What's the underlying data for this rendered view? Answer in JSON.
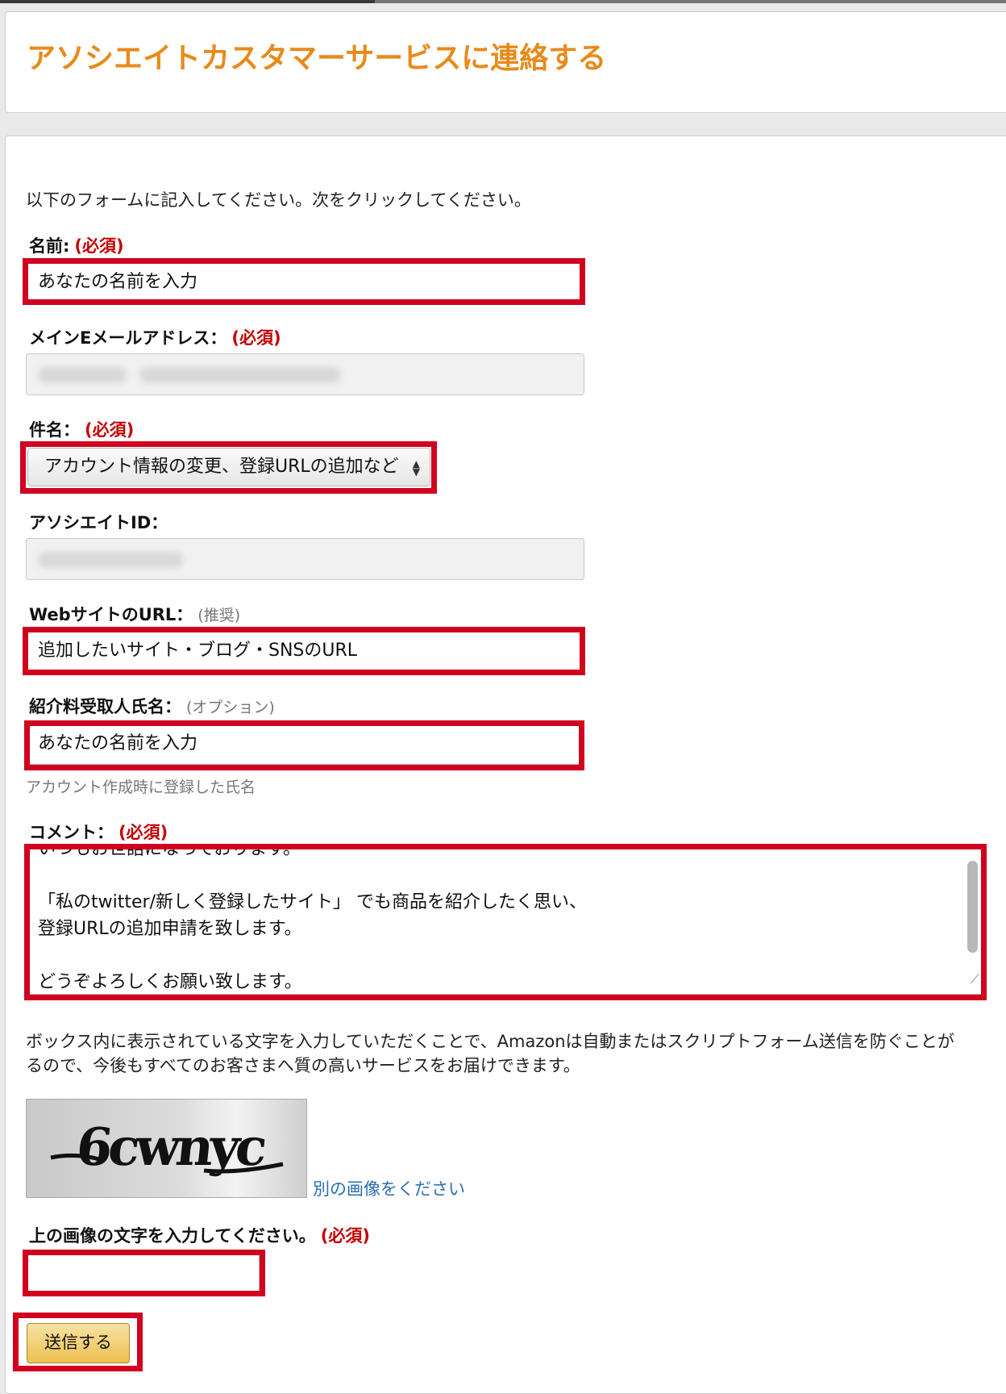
{
  "page": {
    "title": "アソシエイトカスタマーサービスに連絡する"
  },
  "form": {
    "intro": "以下のフォームに記入してください。次をクリックしてください。",
    "required_mark": "(必須)",
    "name": {
      "label": "名前:",
      "value": "あなたの名前を入力"
    },
    "email": {
      "label": "メインEメールアドレス：",
      "value": ""
    },
    "subject": {
      "label": "件名：",
      "selected": "アカウント情報の変更、登録URLの追加など"
    },
    "associate_id": {
      "label": "アソシエイトID：",
      "value": ""
    },
    "website": {
      "label": "WebサイトのURL：",
      "note": "(推奨)",
      "value": "追加したいサイト・ブログ・SNSのURL"
    },
    "payee": {
      "label": "紹介料受取人氏名：",
      "note": "(オプション)",
      "value": "あなたの名前を入力",
      "hint": "アカウント作成時に登録した氏名"
    },
    "comment": {
      "label": "コメント：",
      "lines": [
        "いつもお世話になっております。",
        "",
        "「私のtwitter/新しく登録したサイト」 でも商品を紹介したく思い、",
        "登録URLの追加申請を致します。",
        "",
        "どうぞよろしくお願い致します。"
      ]
    },
    "captcha": {
      "desc_line1": "ボックス内に表示されている文字を入力していただくことで、Amazonは自動またはスクリプトフォーム送信を防ぐことが",
      "desc_line2": "るので、今後もすべてのお客さまへ質の高いサービスをお届けできます。",
      "image_text": "6cwnyc",
      "refresh_link": "別の画像をください",
      "input_label": "上の画像の文字を入力してください。",
      "input_value": ""
    },
    "submit_label": "送信する"
  },
  "colors": {
    "title": "#e88a1a",
    "required": "#c40000",
    "highlight": "#d1001f",
    "link": "#2a6fb3"
  }
}
